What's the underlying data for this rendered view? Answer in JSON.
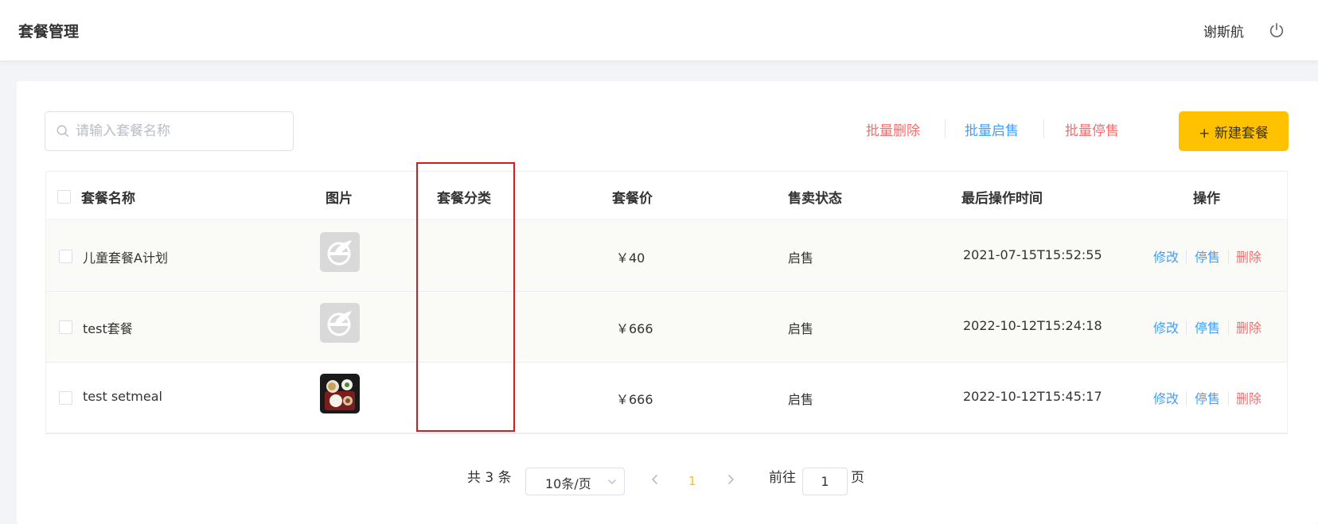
{
  "header": {
    "title": "套餐管理",
    "user_name": "谢斯航",
    "logout_icon": "power-icon"
  },
  "toolbar": {
    "search_placeholder": "请输入套餐名称",
    "search_value": "",
    "batch_delete": "批量删除",
    "batch_enable": "批量启售",
    "batch_disable": "批量停售",
    "new_button": "+ 新建套餐"
  },
  "table": {
    "columns": [
      "套餐名称",
      "图片",
      "套餐分类",
      "套餐价",
      "售卖状态",
      "最后操作时间",
      "操作"
    ],
    "rows": [
      {
        "name": "儿童套餐A计划",
        "image": "placeholder-logo",
        "category": "",
        "price": "￥40",
        "status": "启售",
        "updated": "2021-07-15T15:52:55"
      },
      {
        "name": "test套餐",
        "image": "placeholder-logo",
        "category": "",
        "price": "￥666",
        "status": "启售",
        "updated": "2022-10-12T15:24:18"
      },
      {
        "name": "test setmeal",
        "image": "food-photo",
        "category": "",
        "price": "￥666",
        "status": "启售",
        "updated": "2022-10-12T15:45:17"
      }
    ],
    "actions": {
      "edit": "修改",
      "disable": "停售",
      "delete": "删除"
    }
  },
  "pagination": {
    "total_text": "共 3 条",
    "page_size": "10条/页",
    "current_page": "1",
    "goto_prefix": "前往",
    "goto_value": "1",
    "goto_suffix": "页"
  },
  "colors": {
    "accent": "#ffc200",
    "link_blue": "#419eff",
    "danger_red": "#f56c6c",
    "highlight_red": "#e1171e"
  }
}
